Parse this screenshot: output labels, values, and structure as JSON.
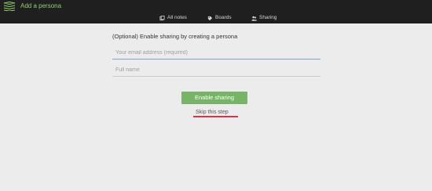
{
  "header": {
    "title": "Add a persona",
    "logo_icon": "stacked-layers-icon",
    "accent_color": "#8fd16f"
  },
  "nav": {
    "items": [
      {
        "label": "All notes",
        "icon": "notes-icon"
      },
      {
        "label": "Boards",
        "icon": "tag-icon"
      },
      {
        "label": "Sharing",
        "icon": "people-icon"
      }
    ]
  },
  "form": {
    "intro": "(Optional) Enable sharing by creating a persona",
    "email_placeholder": "Your email address (required)",
    "email_value": "",
    "name_placeholder": "Full name",
    "name_value": "",
    "submit_label": "Enable sharing",
    "submit_color": "#75b565",
    "skip_label": "Skip this step",
    "skip_underline_color": "#d7344a"
  }
}
